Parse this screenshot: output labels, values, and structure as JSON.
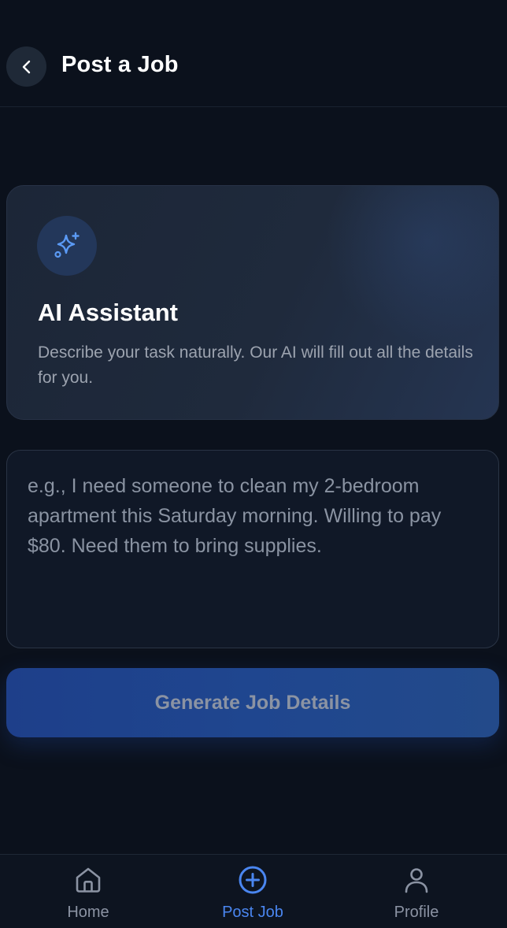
{
  "header": {
    "title": "Post a Job",
    "back_icon": "chevron-left-icon"
  },
  "ai_card": {
    "icon": "sparkles-icon",
    "title": "AI Assistant",
    "description": "Describe your task naturally. Our AI will fill out all the details for you."
  },
  "task_input": {
    "value": "",
    "placeholder": "e.g., I need someone to clean my 2-bedroom apartment this Saturday morning. Willing to pay $80. Need them to bring supplies."
  },
  "generate_button": {
    "label": "Generate Job Details"
  },
  "bottom_nav": {
    "items": [
      {
        "label": "Home",
        "icon": "home-icon",
        "active": false
      },
      {
        "label": "Post Job",
        "icon": "plus-circle-icon",
        "active": true
      },
      {
        "label": "Profile",
        "icon": "user-icon",
        "active": false
      }
    ]
  },
  "colors": {
    "background": "#0b111c",
    "accent": "#4a86f0",
    "button_bg": "#1f468f",
    "muted_text": "#8b93a3"
  }
}
